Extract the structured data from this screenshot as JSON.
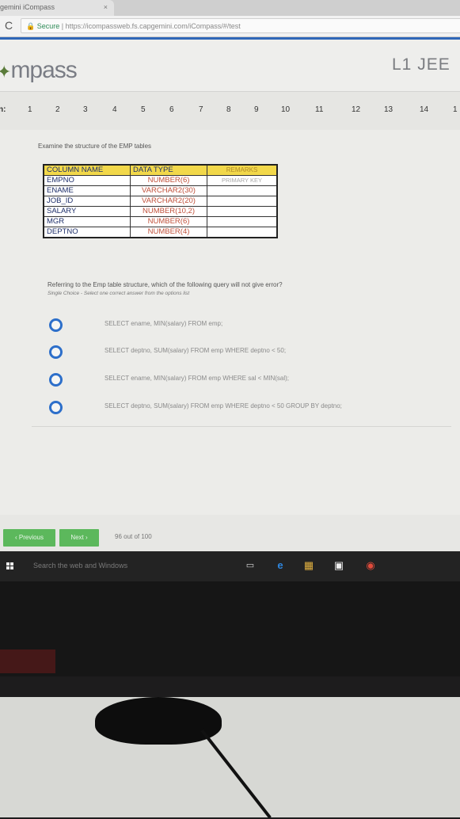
{
  "browser": {
    "tab_title": "gemini iCompass",
    "tab_close": "×",
    "reload_icon": "C",
    "secure_label": "Secure",
    "url": "https://icompassweb.fs.capgemini.com/iCompass/#/test"
  },
  "header": {
    "logo_text": "mpass",
    "level": "L1 JEE"
  },
  "question_nav": {
    "label": "n:",
    "numbers": [
      "1",
      "2",
      "3",
      "4",
      "5",
      "6",
      "7",
      "8",
      "9",
      "10",
      "11",
      "12",
      "13",
      "14",
      "1"
    ]
  },
  "question": {
    "prompt": "Examine the structure of the EMP tables",
    "table": {
      "headers": [
        "COLUMN NAME",
        "DATA TYPE",
        "REMARKS"
      ],
      "rows": [
        [
          "EMPNO",
          "NUMBER(6)",
          "PRIMARY KEY"
        ],
        [
          "ENAME",
          "VARCHAR2(30)",
          ""
        ],
        [
          "JOB_ID",
          "VARCHAR2(20)",
          ""
        ],
        [
          "SALARY",
          "NUMBER(10,2)",
          ""
        ],
        [
          "MGR",
          "NUMBER(6)",
          ""
        ],
        [
          "DEPTNO",
          "NUMBER(4)",
          ""
        ]
      ]
    },
    "text": "Referring to the Emp table structure, which of the following query will not give error?",
    "hint": "Single Choice - Select one correct answer from the options list",
    "options": [
      "SELECT ename, MIN(salary) FROM emp;",
      "SELECT deptno, SUM(salary) FROM emp WHERE deptno < 50;",
      "SELECT ename, MIN(salary) FROM emp  WHERE sal  <  MIN(sal);",
      "SELECT deptno, SUM(salary) FROM emp WHERE deptno < 50  GROUP BY deptno;"
    ]
  },
  "footer": {
    "previous_label": "‹ Previous",
    "next_label": "Next ›",
    "progress": "96 out of 100"
  },
  "taskbar": {
    "search_placeholder": "Search the web and Windows"
  },
  "colors": {
    "accent_blue": "#2d6fca",
    "button_green": "#5cb85c",
    "table_header_yellow": "#f2d84a"
  }
}
